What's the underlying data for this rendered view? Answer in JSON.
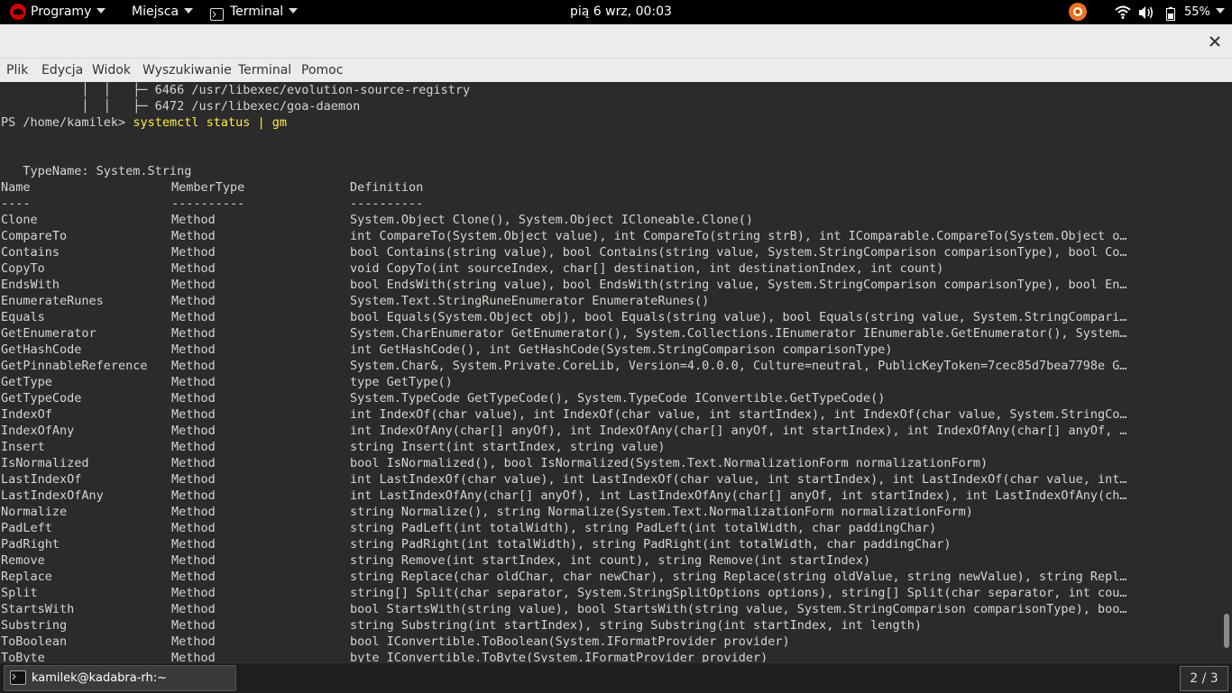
{
  "top_bar": {
    "applications": "Programy",
    "places": "Miejsca",
    "terminal": "Terminal",
    "clock": "pią 6 wrz, 00:03",
    "battery": "55%"
  },
  "menu": [
    "Plik",
    "Edycja",
    "Widok",
    "Wyszukiwanie",
    "Terminal",
    "Pomoc"
  ],
  "terminal": {
    "tree_lines": [
      "           │  │   ├─ 6466 /usr/libexec/evolution-source-registry",
      "           │  │   ├─ 6472 /usr/libexec/goa-daemon"
    ],
    "prompt": "PS /home/kamilek> ",
    "command": "systemctl status | gm",
    "typename": "   TypeName: System.String",
    "headers": [
      "Name",
      "MemberType",
      "Definition"
    ],
    "dashes": [
      "----",
      "----------",
      "----------"
    ],
    "rows": [
      [
        "Clone",
        "Method",
        "System.Object Clone(), System.Object ICloneable.Clone()"
      ],
      [
        "CompareTo",
        "Method",
        "int CompareTo(System.Object value), int CompareTo(string strB), int IComparable.CompareTo(System.Object o…"
      ],
      [
        "Contains",
        "Method",
        "bool Contains(string value), bool Contains(string value, System.StringComparison comparisonType), bool Co…"
      ],
      [
        "CopyTo",
        "Method",
        "void CopyTo(int sourceIndex, char[] destination, int destinationIndex, int count)"
      ],
      [
        "EndsWith",
        "Method",
        "bool EndsWith(string value), bool EndsWith(string value, System.StringComparison comparisonType), bool En…"
      ],
      [
        "EnumerateRunes",
        "Method",
        "System.Text.StringRuneEnumerator EnumerateRunes()"
      ],
      [
        "Equals",
        "Method",
        "bool Equals(System.Object obj), bool Equals(string value), bool Equals(string value, System.StringCompari…"
      ],
      [
        "GetEnumerator",
        "Method",
        "System.CharEnumerator GetEnumerator(), System.Collections.IEnumerator IEnumerable.GetEnumerator(), System…"
      ],
      [
        "GetHashCode",
        "Method",
        "int GetHashCode(), int GetHashCode(System.StringComparison comparisonType)"
      ],
      [
        "GetPinnableReference",
        "Method",
        "System.Char&, System.Private.CoreLib, Version=4.0.0.0, Culture=neutral, PublicKeyToken=7cec85d7bea7798e G…"
      ],
      [
        "GetType",
        "Method",
        "type GetType()"
      ],
      [
        "GetTypeCode",
        "Method",
        "System.TypeCode GetTypeCode(), System.TypeCode IConvertible.GetTypeCode()"
      ],
      [
        "IndexOf",
        "Method",
        "int IndexOf(char value), int IndexOf(char value, int startIndex), int IndexOf(char value, System.StringCo…"
      ],
      [
        "IndexOfAny",
        "Method",
        "int IndexOfAny(char[] anyOf), int IndexOfAny(char[] anyOf, int startIndex), int IndexOfAny(char[] anyOf, …"
      ],
      [
        "Insert",
        "Method",
        "string Insert(int startIndex, string value)"
      ],
      [
        "IsNormalized",
        "Method",
        "bool IsNormalized(), bool IsNormalized(System.Text.NormalizationForm normalizationForm)"
      ],
      [
        "LastIndexOf",
        "Method",
        "int LastIndexOf(char value), int LastIndexOf(char value, int startIndex), int LastIndexOf(char value, int…"
      ],
      [
        "LastIndexOfAny",
        "Method",
        "int LastIndexOfAny(char[] anyOf), int LastIndexOfAny(char[] anyOf, int startIndex), int LastIndexOfAny(ch…"
      ],
      [
        "Normalize",
        "Method",
        "string Normalize(), string Normalize(System.Text.NormalizationForm normalizationForm)"
      ],
      [
        "PadLeft",
        "Method",
        "string PadLeft(int totalWidth), string PadLeft(int totalWidth, char paddingChar)"
      ],
      [
        "PadRight",
        "Method",
        "string PadRight(int totalWidth), string PadRight(int totalWidth, char paddingChar)"
      ],
      [
        "Remove",
        "Method",
        "string Remove(int startIndex, int count), string Remove(int startIndex)"
      ],
      [
        "Replace",
        "Method",
        "string Replace(char oldChar, char newChar), string Replace(string oldValue, string newValue), string Repl…"
      ],
      [
        "Split",
        "Method",
        "string[] Split(char separator, System.StringSplitOptions options), string[] Split(char separator, int cou…"
      ],
      [
        "StartsWith",
        "Method",
        "bool StartsWith(string value), bool StartsWith(string value, System.StringComparison comparisonType), boo…"
      ],
      [
        "Substring",
        "Method",
        "string Substring(int startIndex), string Substring(int startIndex, int length)"
      ],
      [
        "ToBoolean",
        "Method",
        "bool IConvertible.ToBoolean(System.IFormatProvider provider)"
      ],
      [
        "ToByte",
        "Method",
        "byte IConvertible.ToByte(System.IFormatProvider provider)"
      ]
    ]
  },
  "taskbar": {
    "window_title": "kamilek@kadabra-rh:~",
    "workspace": "2 / 3"
  },
  "colors": {
    "terminal_bg": "#2b2b2b",
    "terminal_fg": "#d3d7cf",
    "command_fg": "#fce94f",
    "menubar_bg": "#ececeb"
  }
}
